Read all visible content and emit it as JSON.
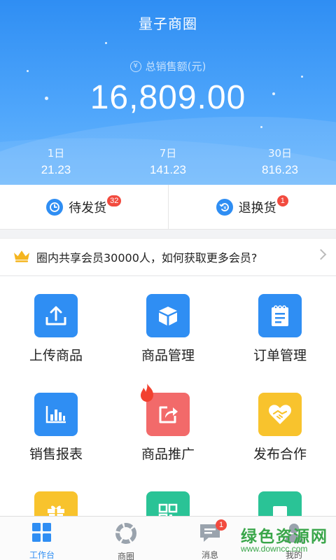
{
  "header": {
    "title": "量子商圈",
    "sales_label": "总销售额(元)",
    "sales_value": "16,809.00",
    "periods": [
      {
        "label": "1日",
        "value": "21.23"
      },
      {
        "label": "7日",
        "value": "141.23"
      },
      {
        "label": "30日",
        "value": "816.23"
      }
    ]
  },
  "orders": {
    "pending": {
      "label": "待发货",
      "count": "32"
    },
    "returns": {
      "label": "退换货",
      "count": "1"
    }
  },
  "banner": {
    "text": "圈内共享会员30000人，如何获取更多会员?"
  },
  "grid": {
    "upload": "上传商品",
    "manage": "商品管理",
    "orders": "订单管理",
    "report": "销售报表",
    "promote": "商品推广",
    "cooperate": "发布合作"
  },
  "tabs": {
    "workbench": "工作台",
    "circle": "商圈",
    "messages": "消息",
    "messages_badge": "1",
    "mine": "我的"
  },
  "watermark": {
    "text": "绿色资源网",
    "url": "www.downcc.com"
  },
  "colors": {
    "primary": "#2f8ef3",
    "badge": "#f24b3f",
    "promote": "#f26a6a",
    "cooperate": "#f8c32d",
    "green_tile": "#2ac396"
  }
}
